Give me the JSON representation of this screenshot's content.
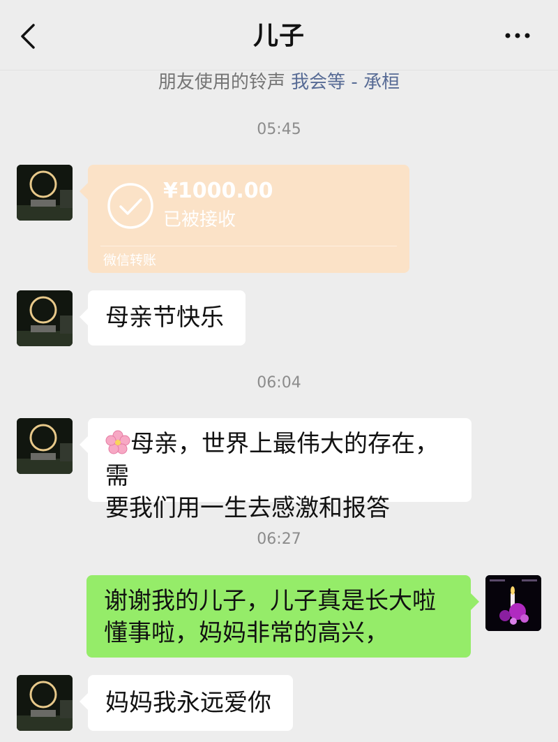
{
  "header": {
    "title": "儿子",
    "back_icon": "chevron-left-icon",
    "more_icon": "more-dots-icon"
  },
  "ringtone": {
    "prefix": "朋友使用的铃声",
    "song": "我会等 - 承桓"
  },
  "messages": {
    "time1": "05:45",
    "transfer": {
      "amount": "¥1000.00",
      "status": "已被接收",
      "kind": "微信转账",
      "icon": "check-circle-icon"
    },
    "msg1": "母亲节快乐",
    "time2": "06:04",
    "msg2_icon": "cherry-blossom-icon",
    "msg2_line1": "母亲，世界上最伟大的存在，需",
    "msg2_line2": "要我们用一生去感激和报答",
    "time3": "06:27",
    "reply_line1": "谢谢我的儿子，儿子真是长大啦",
    "reply_line2": "懂事啦，妈妈非常的高兴，",
    "msg3": "妈妈我永远爱你"
  },
  "colors": {
    "background": "#ededed",
    "incoming_bubble": "#ffffff",
    "outgoing_bubble": "#95ec69",
    "transfer_card": "#fbe2c7",
    "link": "#576b95"
  }
}
